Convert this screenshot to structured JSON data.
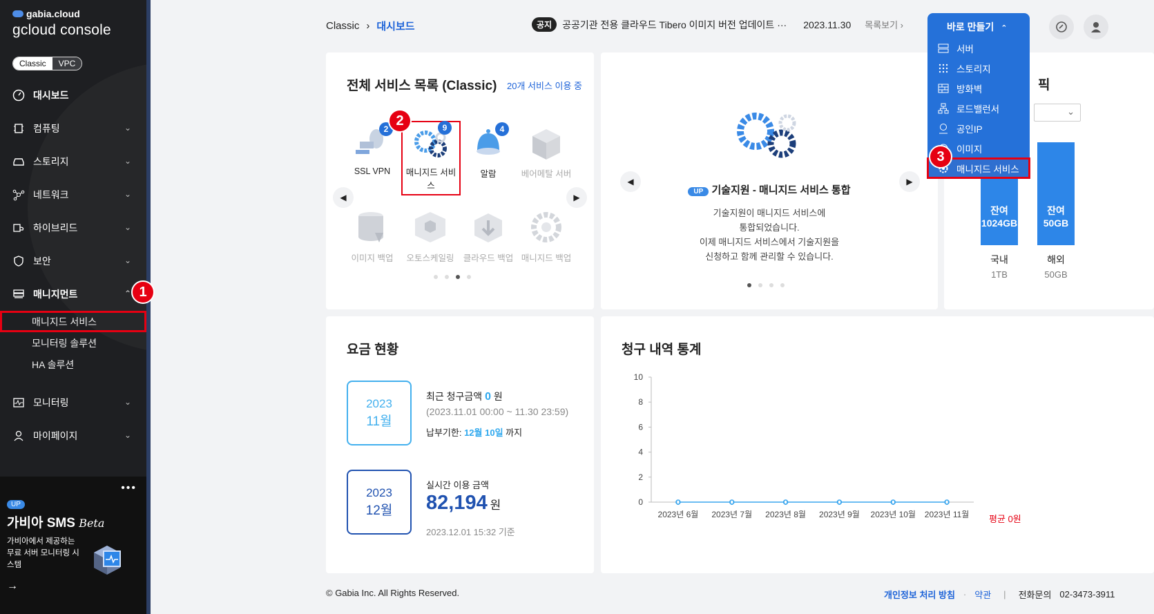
{
  "brand": {
    "top": "gabia.cloud",
    "name": "gcloud console"
  },
  "mode": {
    "classic": "Classic",
    "vpc": "VPC"
  },
  "sidebar": {
    "items": [
      {
        "label": "대시보드",
        "icon": "dashboard-icon"
      },
      {
        "label": "컴퓨팅",
        "icon": "cpu-icon"
      },
      {
        "label": "스토리지",
        "icon": "storage-icon"
      },
      {
        "label": "네트워크",
        "icon": "network-icon"
      },
      {
        "label": "하이브리드",
        "icon": "hybrid-icon"
      },
      {
        "label": "보안",
        "icon": "shield-icon"
      },
      {
        "label": "매니지먼트",
        "icon": "server-icon"
      },
      {
        "label": "모니터링",
        "icon": "monitor-icon"
      },
      {
        "label": "마이페이지",
        "icon": "user-icon"
      }
    ],
    "sub_items": [
      "매니지드 서비스",
      "모니터링 솔루션",
      "HA 솔루션"
    ]
  },
  "sms": {
    "badge": "UP",
    "title": "가비아 SMS",
    "title_suffix": "Beta",
    "desc": "가비아에서 제공하는 무료 서버 모니터링 시스템",
    "arrow": "→",
    "dots": "•••"
  },
  "callouts": [
    "1",
    "2",
    "3"
  ],
  "breadcrumb": {
    "root": "Classic",
    "sep": "›",
    "current": "대시보드"
  },
  "notice": {
    "tag": "공지",
    "text": "공공기관 전용 클라우드 Tibero 이미지 버전 업데이트 ···",
    "date": "2023.11.30",
    "more": "목록보기 ›"
  },
  "services": {
    "title": "전체 서비스 목록 (Classic)",
    "count": "20개 서비스 이용 중",
    "items": [
      {
        "label": "SSL VPN",
        "count": "2"
      },
      {
        "label": "매니지드 서비스",
        "count": "9"
      },
      {
        "label": "알람",
        "count": "4"
      },
      {
        "label": "베어메탈 서버",
        "count": ""
      },
      {
        "label": "이미지 백업",
        "count": ""
      },
      {
        "label": "오토스케일링",
        "count": ""
      },
      {
        "label": "클라우드 백업",
        "count": ""
      },
      {
        "label": "매니지드 백업",
        "count": ""
      }
    ]
  },
  "banner": {
    "badge": "UP",
    "title": "기술지원 - 매니지드 서비스 통합",
    "lines": [
      "기술지원이 매니지드 서비스에",
      "통합되었습니다.",
      "이제 매니지드 서비스에서 기술지원을",
      "신청하고 함께 관리할 수 있습니다."
    ]
  },
  "quick_create": {
    "title": "바로 만들기",
    "items": [
      {
        "label": "서버",
        "icon": "server-icon"
      },
      {
        "label": "스토리지",
        "icon": "grid-icon"
      },
      {
        "label": "방화벽",
        "icon": "firewall-icon"
      },
      {
        "label": "로드밸런서",
        "icon": "loadbalancer-icon"
      },
      {
        "label": "공인IP",
        "icon": "pin-icon"
      },
      {
        "label": "이미지",
        "icon": "image-icon"
      },
      {
        "label": "매니지드 서비스",
        "icon": "gear-icon"
      }
    ]
  },
  "traffic": {
    "title_fragment": "픽",
    "bars": [
      {
        "label1": "잔여",
        "label2": "1024GB",
        "region": "국내",
        "total": "1TB"
      },
      {
        "label1": "잔여",
        "label2": "50GB",
        "region": "해외",
        "total": "50GB"
      }
    ]
  },
  "fee": {
    "title": "요금 현황",
    "recent": {
      "year": "2023",
      "month": "11월",
      "label": "최근 청구금액",
      "amount": "0",
      "unit": "원",
      "range": "(2023.11.01 00:00 ~ 11.30 23:59)",
      "due_label": "납부기한:",
      "due_date": "12월 10일",
      "due_suffix": "까지"
    },
    "realtime": {
      "year": "2023",
      "month": "12월",
      "label": "실시간 이용 금액",
      "amount": "82,194",
      "unit": "원",
      "asof": "2023.12.01 15:32 기준"
    }
  },
  "billing_stats": {
    "title": "청구 내역 통계",
    "avg_label": "평균 0원"
  },
  "chart_data": {
    "type": "line",
    "categories": [
      "2023년 6월",
      "2023년 7월",
      "2023년 8월",
      "2023년 9월",
      "2023년 10월",
      "2023년 11월"
    ],
    "values": [
      0,
      0,
      0,
      0,
      0,
      0
    ],
    "ylim": [
      0,
      10
    ],
    "yticks": [
      0,
      2,
      4,
      6,
      8,
      10
    ],
    "color": "#3aa6ee"
  },
  "footer": {
    "copyright": "© Gabia Inc. All Rights Reserved.",
    "privacy": "개인정보 처리 방침",
    "dot": "·",
    "terms": "약관",
    "bar": "|",
    "phone_label": "전화문의",
    "phone": "02-3473-3911"
  }
}
